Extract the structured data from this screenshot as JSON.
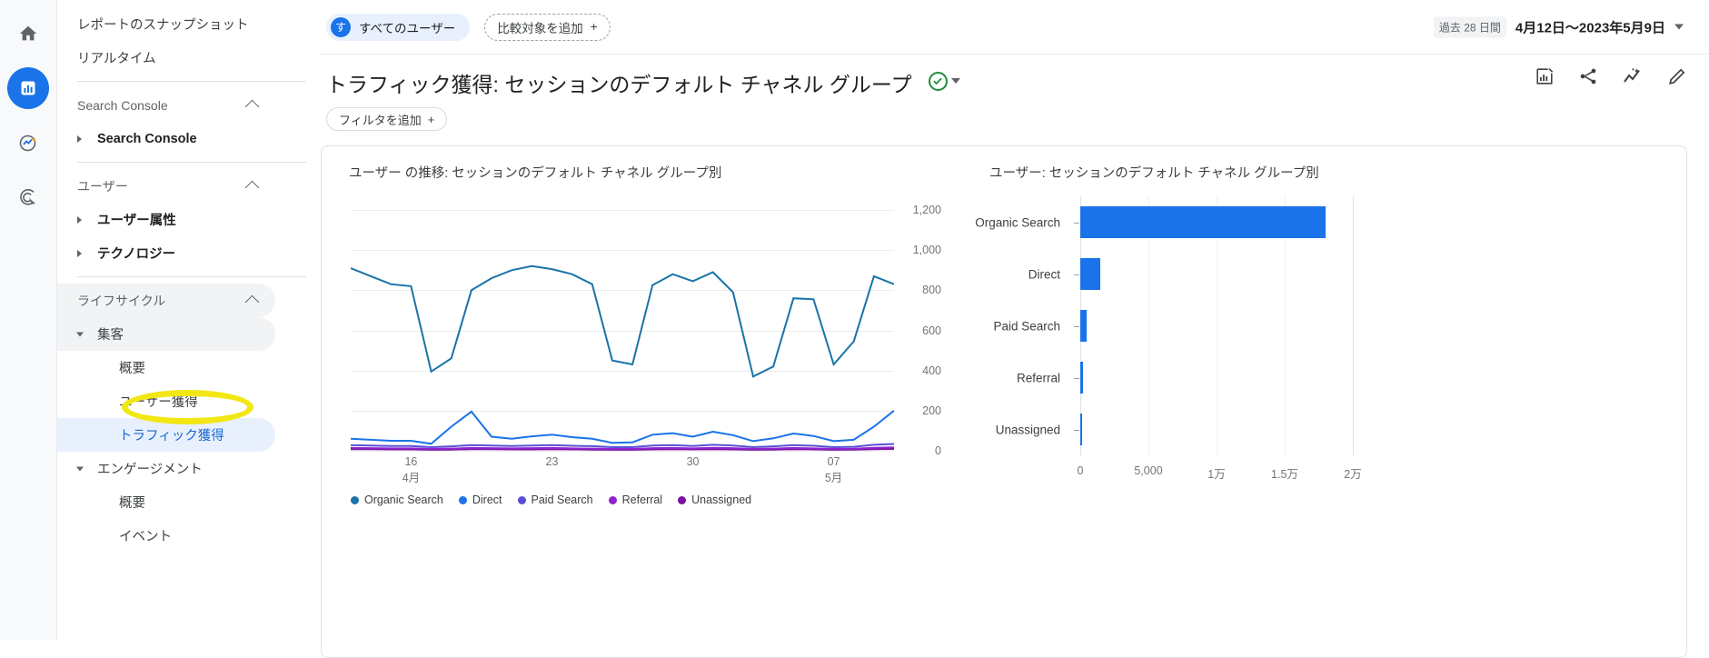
{
  "rail": {
    "items": [
      {
        "name": "home-icon",
        "label": "ホーム",
        "active": false
      },
      {
        "name": "reports-icon",
        "label": "レポート",
        "active": true
      },
      {
        "name": "explore-icon",
        "label": "探索",
        "active": false
      },
      {
        "name": "advertising-icon",
        "label": "広告",
        "active": false
      }
    ]
  },
  "sidebar": {
    "items": [
      {
        "label": "レポートのスナップショット",
        "type": "item",
        "indent": 0
      },
      {
        "label": "リアルタイム",
        "type": "item",
        "indent": 0
      },
      {
        "label": "divider",
        "type": "divider",
        "indent": 0
      },
      {
        "label": "Search Console",
        "type": "section",
        "indent": 0
      },
      {
        "label": "Search Console",
        "type": "expandable",
        "indent": 1,
        "bold": true
      },
      {
        "label": "divider",
        "type": "divider",
        "indent": 0
      },
      {
        "label": "ユーザー",
        "type": "section",
        "indent": 0
      },
      {
        "label": "ユーザー属性",
        "type": "expandable",
        "indent": 1,
        "bold": true
      },
      {
        "label": "テクノロジー",
        "type": "expandable",
        "indent": 1,
        "bold": true
      },
      {
        "label": "divider",
        "type": "divider",
        "indent": 0
      },
      {
        "label": "ライフサイクル",
        "type": "section",
        "indent": 0,
        "grey": true
      },
      {
        "label": "集客",
        "type": "expanded",
        "indent": 1,
        "grey": true
      },
      {
        "label": "概要",
        "type": "item",
        "indent": 2
      },
      {
        "label": "ユーザー獲得",
        "type": "item",
        "indent": 2
      },
      {
        "label": "トラフィック獲得",
        "type": "item",
        "indent": 2,
        "selected": true
      },
      {
        "label": "エンゲージメント",
        "type": "expanded",
        "indent": 1
      },
      {
        "label": "概要",
        "type": "item",
        "indent": 2
      },
      {
        "label": "イベント",
        "type": "item",
        "indent": 2
      }
    ],
    "highlight_color": "#f2e713"
  },
  "topbar": {
    "audience_chip": {
      "avatar": "す",
      "label": "すべてのユーザー"
    },
    "compare_chip": {
      "label": "比較対象を追加",
      "plus": "+"
    },
    "date": {
      "badge": "過去 28 日間",
      "range": "4月12日〜2023年5月9日"
    }
  },
  "title": {
    "text": "トラフィック獲得: セッションのデフォルト チャネル グループ",
    "filter_chip": {
      "label": "フィルタを追加",
      "plus": "+"
    },
    "actions": [
      {
        "name": "insights-icon"
      },
      {
        "name": "share-icon"
      },
      {
        "name": "compare-icon"
      },
      {
        "name": "edit-icon"
      }
    ]
  },
  "chart_data": [
    {
      "type": "line",
      "panel": "line",
      "title": "ユーザー の推移: セッションのデフォルト チャネル グループ別",
      "xlabel": "",
      "ylabel": "",
      "ylim": [
        0,
        1200
      ],
      "yticks": [
        1200,
        1000,
        800,
        600,
        400,
        200,
        0
      ],
      "yticklabels": [
        "1,200",
        "1,000",
        "800",
        "600",
        "400",
        "200",
        "0"
      ],
      "grid": true,
      "legend_position": "bottom",
      "x": [
        1,
        2,
        3,
        4,
        5,
        6,
        7,
        8,
        9,
        10,
        11,
        12,
        13,
        14,
        15,
        16,
        17,
        18,
        19,
        20,
        21,
        22,
        23,
        24,
        25,
        26,
        27,
        28
      ],
      "xticks": [
        {
          "pos": 4,
          "label": "16",
          "sub": "4月"
        },
        {
          "pos": 11,
          "label": "23",
          "sub": ""
        },
        {
          "pos": 18,
          "label": "30",
          "sub": ""
        },
        {
          "pos": 25,
          "label": "07",
          "sub": "5月"
        }
      ],
      "series": [
        {
          "name": "Organic Search",
          "color": "#1a73a8",
          "values": [
            910,
            870,
            830,
            820,
            395,
            460,
            800,
            860,
            900,
            920,
            905,
            880,
            830,
            450,
            430,
            825,
            880,
            845,
            890,
            790,
            370,
            420,
            760,
            755,
            430,
            545,
            870,
            830
          ]
        },
        {
          "name": "Direct",
          "color": "#1a73e8",
          "values": [
            60,
            55,
            50,
            50,
            35,
            120,
            195,
            70,
            60,
            72,
            80,
            68,
            60,
            40,
            42,
            80,
            88,
            70,
            95,
            78,
            48,
            62,
            86,
            74,
            48,
            55,
            120,
            200
          ]
        },
        {
          "name": "Paid Search",
          "color": "#5b4fd6",
          "values": [
            28,
            26,
            24,
            24,
            18,
            22,
            28,
            26,
            24,
            26,
            28,
            25,
            23,
            18,
            18,
            26,
            28,
            24,
            30,
            26,
            18,
            22,
            28,
            25,
            18,
            20,
            30,
            34
          ]
        },
        {
          "name": "Referral",
          "color": "#8e24d0",
          "values": [
            14,
            13,
            12,
            12,
            9,
            11,
            14,
            13,
            12,
            13,
            14,
            12,
            11,
            9,
            9,
            13,
            14,
            12,
            15,
            13,
            9,
            11,
            14,
            12,
            9,
            10,
            15,
            17
          ]
        },
        {
          "name": "Unassigned",
          "color": "#7b0f9e",
          "values": [
            8,
            8,
            7,
            7,
            5,
            6,
            8,
            8,
            7,
            7,
            8,
            7,
            6,
            5,
            5,
            7,
            8,
            7,
            8,
            7,
            5,
            6,
            8,
            7,
            5,
            6,
            8,
            9
          ]
        }
      ]
    },
    {
      "type": "bar",
      "panel": "bar",
      "orientation": "horizontal",
      "title": "ユーザー: セッションのデフォルト チャネル グループ別",
      "categories": [
        "Organic Search",
        "Direct",
        "Paid Search",
        "Referral",
        "Unassigned"
      ],
      "values": [
        18000,
        1450,
        450,
        190,
        40
      ],
      "bar_color": "#1a73e8",
      "xlim": [
        0,
        20000
      ],
      "xticks": [
        0,
        5000,
        10000,
        15000,
        20000
      ],
      "xticklabels": [
        "0",
        "5,000",
        "1万",
        "1.5万",
        "2万"
      ],
      "grid": true
    }
  ]
}
